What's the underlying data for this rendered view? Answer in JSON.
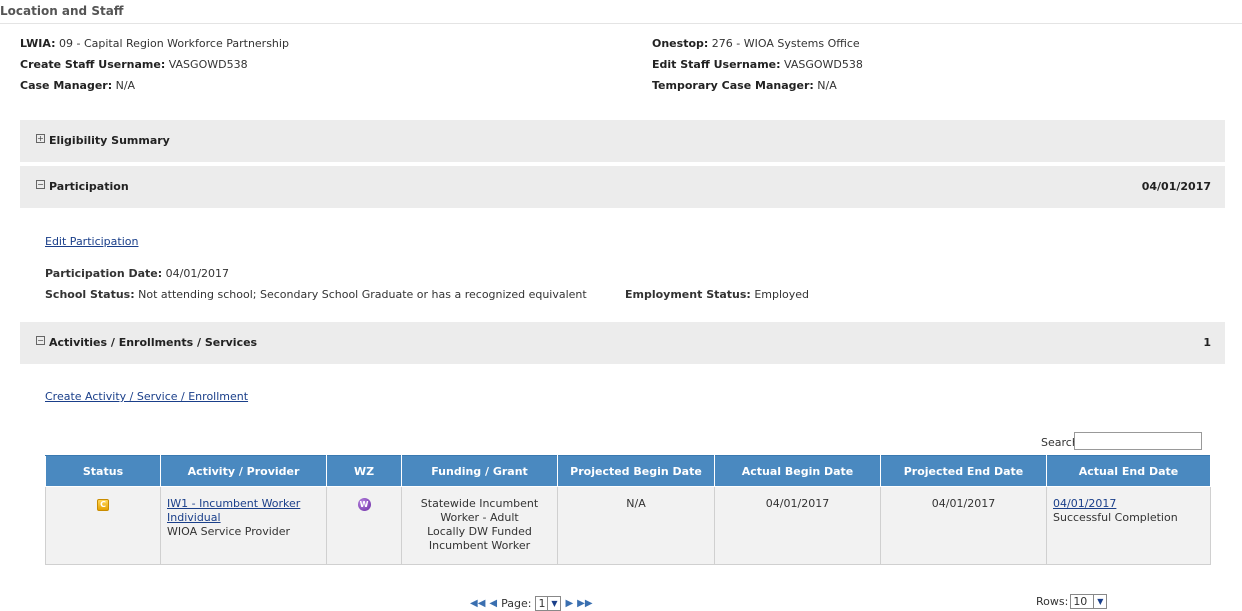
{
  "section": {
    "title": "Location and Staff"
  },
  "info": {
    "lwia_label": "LWIA:",
    "lwia_value": " 09 - Capital Region Workforce Partnership",
    "create_label": "Create Staff Username:",
    "create_value": " VASGOWD538",
    "case_label": "Case Manager:",
    "case_value": " N/A",
    "onestop_label": "Onestop:",
    "onestop_value": " 276 - WIOA Systems Office",
    "edit_label": "Edit Staff Username:",
    "edit_value": " VASGOWD538",
    "temp_label": "Temporary Case Manager:",
    "temp_value": " N/A"
  },
  "bars": {
    "eligibility": {
      "toggle": "⊞",
      "label": "Eligibility Summary"
    },
    "participation": {
      "toggle": "⊟",
      "label": "Participation",
      "right": "04/01/2017"
    },
    "activities": {
      "toggle": "⊟",
      "label": "Activities / Enrollments / Services",
      "right": "1"
    }
  },
  "participation": {
    "edit_link": "Edit Participation",
    "date_label": "Participation Date:",
    "date_value": " 04/01/2017",
    "school_label": "School Status:",
    "school_value": " Not attending school; Secondary School Graduate or has a recognized equivalent",
    "employment_label": "Employment Status:",
    "employment_value": " Employed"
  },
  "activities": {
    "create_link": "Create Activity / Service / Enrollment",
    "search_label": "Search:",
    "search_value": "",
    "columns": [
      "Status",
      "Activity / Provider",
      "WZ",
      "Funding / Grant",
      "Projected Begin Date",
      "Actual Begin Date",
      "Projected End Date",
      "Actual End Date"
    ],
    "row": {
      "status_icon": "C",
      "activity_link": "IW1 - Incumbent Worker Individual",
      "provider": "WIOA Service Provider",
      "wz_icon": "W",
      "funding": "Statewide Incumbent Worker - Adult",
      "grant": "Locally DW Funded Incumbent Worker",
      "projected_begin": "N/A",
      "actual_begin": "04/01/2017",
      "projected_end": "04/01/2017",
      "actual_end_link": "04/01/2017",
      "actual_end_note": "Successful Completion"
    }
  },
  "pager": {
    "first": "⏮",
    "prev": "◀",
    "page_label": "Page:",
    "page_value": "1",
    "next": "▶",
    "last": "⏭",
    "rows_label": "Rows:",
    "rows_value": "10"
  },
  "colors": {
    "header_blue": "#4a89c0",
    "bar_gray": "#ececec",
    "link": "#1a3f8a"
  }
}
